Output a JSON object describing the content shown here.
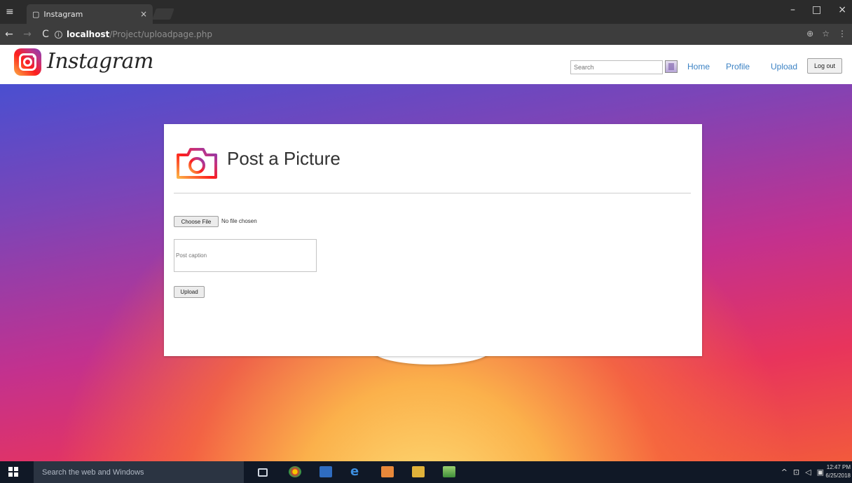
{
  "browser": {
    "tab_title": "Instagram",
    "tab_close": "×",
    "url_host": "localhost",
    "url_path": "/Project/uploadpage.php",
    "window_controls": [
      "–",
      "□",
      "×"
    ]
  },
  "header": {
    "logo_text": "Instagram",
    "search_placeholder": "Search",
    "nav": [
      "Home",
      "Profile",
      "Upload"
    ],
    "logout_label": "Log out"
  },
  "card": {
    "title": "Post a Picture",
    "file_button": "Choose File",
    "file_status": "No file chosen",
    "caption_placeholder": "Post caption",
    "upload_button": "Upload"
  },
  "taskbar": {
    "search_text": "Search the web and Windows",
    "time": "12:47 PM",
    "date": "6/25/2018"
  },
  "colors": {
    "link": "#3b82c4",
    "gradient_top": "#4a4fd0",
    "gradient_mid": "#c3318e",
    "gradient_bottom": "#fbb14b"
  }
}
